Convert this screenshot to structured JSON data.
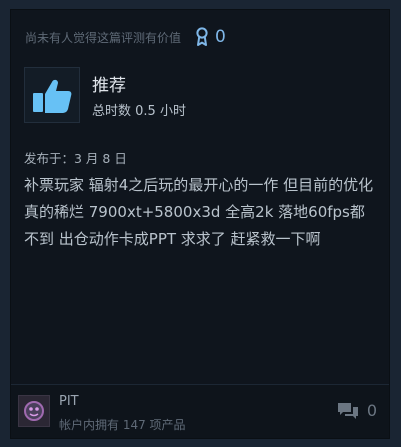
{
  "review": {
    "helpful_text": "尚未有人觉得这篇评测有价值",
    "award_count": "0",
    "recommendation": "推荐",
    "hours_on_record": "总时数 0.5 小时",
    "posted_date": "发布于：3 月 8 日",
    "content": "补票玩家 辐射4之后玩的最开心的一作 但目前的优化真的稀烂 7900xt+5800x3d 全高2k 落地60fps都不到 出仓动作卡成PPT 求求了 赶紧救一下啊"
  },
  "author": {
    "name": "PIT",
    "products": "帐户内拥有 147 项产品"
  },
  "footer": {
    "comment_count": "0"
  },
  "colors": {
    "accent": "#7fb7e8",
    "thumb": "#67c1f5",
    "card_bg": "#0f151d"
  }
}
